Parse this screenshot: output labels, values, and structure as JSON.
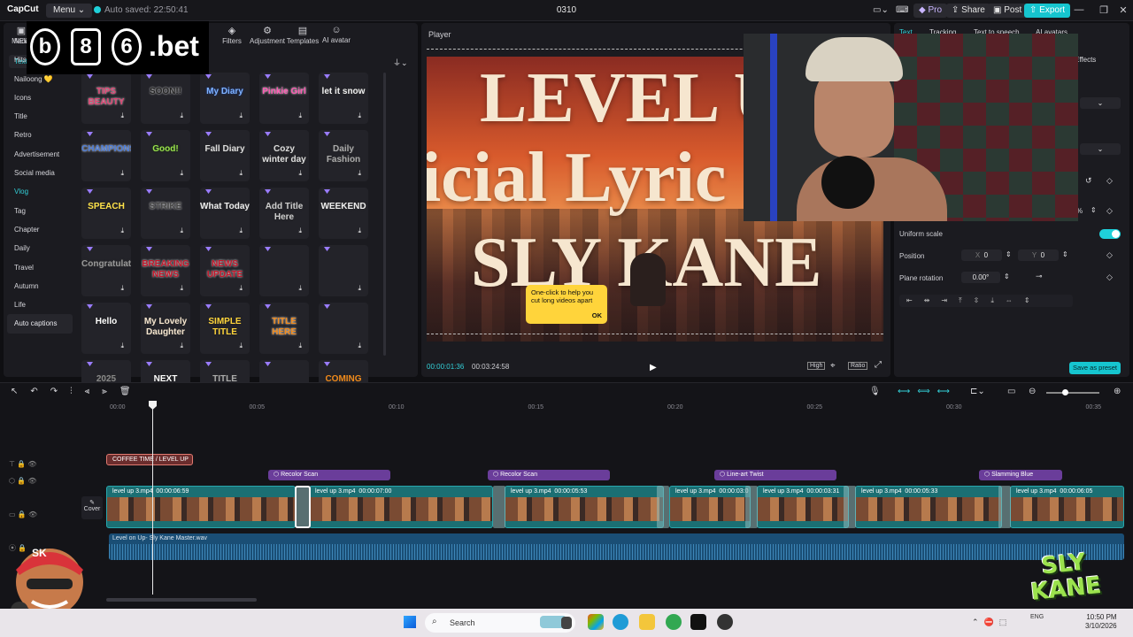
{
  "app": {
    "name": "CapCut",
    "menu": "Menu",
    "autosave": "Auto saved: 22:50:41",
    "project": "0310"
  },
  "topbar": {
    "pro": "Pro",
    "share": "Share",
    "post": "Post",
    "export": "Export",
    "minimize": "—",
    "maximize": "❐",
    "close": "✕"
  },
  "brand": {
    "text": ".bet",
    "digits": [
      "b",
      "8",
      "6"
    ]
  },
  "tools": [
    {
      "label": "Media",
      "icon": "media-icon"
    },
    {
      "label": "Filters",
      "icon": "filters-icon"
    },
    {
      "label": "Adjustment",
      "icon": "adjustment-icon"
    },
    {
      "label": "Templates",
      "icon": "templates-icon"
    },
    {
      "label": "AI avatar",
      "icon": "ai-avatar-icon"
    }
  ],
  "text_tab": "Text",
  "categories": [
    "NEW",
    "Hits",
    "Nailoong 💛",
    "Icons",
    "Title",
    "Retro",
    "Advertisement",
    "Social media",
    "Vlog",
    "Tag",
    "Chapter",
    "Daily",
    "Travel",
    "Autumn",
    "Life",
    "Auto captions"
  ],
  "templates": [
    [
      "TIPS BEAUTY",
      "SOON!!",
      "My Diary",
      "Pinkie Girl",
      "let it snow"
    ],
    [
      "CHAMPIONS",
      "Good!",
      "Fall Diary",
      "Cozy winter day",
      "Daily Fashion"
    ],
    [
      "SPEACH",
      "STRIKE",
      "What Today",
      "Add Title Here",
      "WEEKEND"
    ],
    [
      "Congratulations",
      "BREAKING NEWS",
      "NEWS UPDATE",
      "",
      ""
    ],
    [
      "Hello",
      "My Lovely Daughter",
      "SIMPLE TITLE",
      "TITLE HERE",
      ""
    ],
    [
      "2025",
      "NEXT",
      "TITLE",
      "",
      "COMING"
    ]
  ],
  "player": {
    "label": "Player",
    "lyrics": [
      "LEVEL U",
      "icial Lyric",
      "SLY KANE"
    ],
    "tooltip": "One-click to help you cut long videos apart",
    "tooltip_ok": "OK",
    "current_time": "00:00:01:36",
    "total_time": "00:03:24:58",
    "buttons": [
      "High",
      "Ratio"
    ]
  },
  "right_panel": {
    "tabs": [
      "Text",
      "Tracking",
      "Text to speech",
      "AI avatars"
    ],
    "effects": "Effects",
    "uniform_scale": "Uniform scale",
    "position_label": "Position",
    "pos_x_label": "X",
    "pos_x": "0",
    "pos_y_label": "Y",
    "pos_y": "0",
    "rotation_label": "Plane rotation",
    "rotation": "0.00°",
    "save_preset": "Save as preset",
    "scale_pct": "%"
  },
  "timeline": {
    "ticks": [
      "00:00",
      "00:05",
      "00:10",
      "00:15",
      "00:20",
      "00:25",
      "00:30",
      "00:35"
    ],
    "text_clip": "COFFEE TIME / LEVEL UP",
    "effects": [
      {
        "label": "Recolor Scan"
      },
      {
        "label": "Recolor Scan"
      },
      {
        "label": "Line-art Twist"
      },
      {
        "label": "Slamming Blue"
      }
    ],
    "video_clips": [
      {
        "name": "level up 3.mp4",
        "dur": "00:00:06:59"
      },
      {
        "name": "level up 3.mp4",
        "dur": "00:00:07:00"
      },
      {
        "name": "level up 3.mp4",
        "dur": "00:00:05:53"
      },
      {
        "name": "level up 3.mp4",
        "dur": "00:00:03:0"
      },
      {
        "name": "level up 3.mp4",
        "dur": "00:00:03:31"
      },
      {
        "name": "level up 3.mp4",
        "dur": "00:00:05:33"
      },
      {
        "name": "level up 3.mp4",
        "dur": "00:00:06:05"
      }
    ],
    "cover": "Cover",
    "audio": "Level on Up- Sly Kane Master.wav"
  },
  "taskbar": {
    "search": "Search",
    "time": "10:50 PM",
    "date": "3/10/2026",
    "lang": "ENG"
  },
  "overlay": {
    "sk": "SK",
    "brand_logo": "SLY KANE"
  }
}
